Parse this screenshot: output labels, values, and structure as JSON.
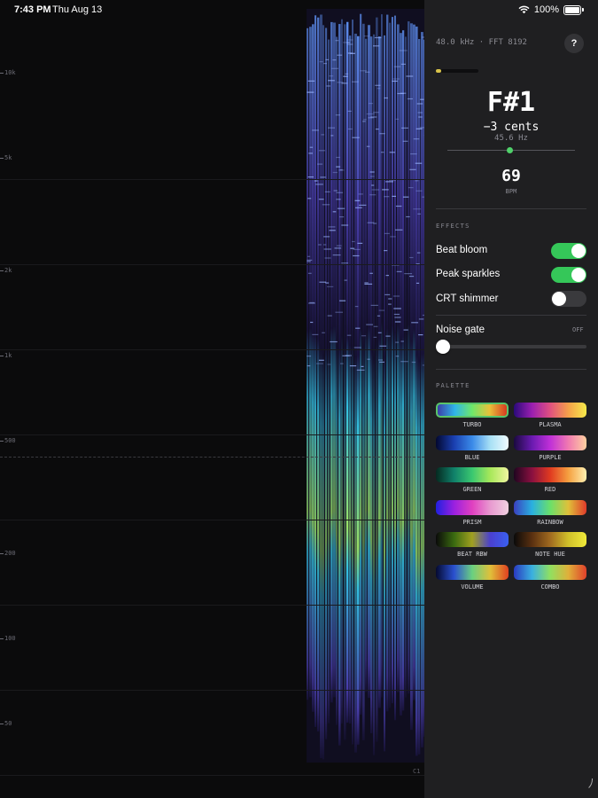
{
  "status_bar": {
    "time": "7:43 PM",
    "date": "Thu Aug 13",
    "battery": "100%"
  },
  "spectrogram": {
    "y_ticks": [
      "10k",
      "5k",
      "2k",
      "1k",
      "500",
      "200",
      "100",
      "50"
    ],
    "bottom_label": "C1",
    "gradient_colors": [
      "#1a1440",
      "#4a3fb0",
      "#5d8ff0",
      "#35c7e8",
      "#9ee86a",
      "#e8e24a"
    ]
  },
  "panel": {
    "meta": "48.0 kHz · FFT 8192",
    "help_label": "?",
    "level": 0.12,
    "note": "F#1",
    "cents": "−3 cents",
    "frequency": "45.6 Hz",
    "tuning_offset": -0.03,
    "bpm_value": "69",
    "bpm_label": "BPM",
    "effects": {
      "title": "EFFECTS",
      "items": [
        {
          "label": "Beat bloom",
          "on": true
        },
        {
          "label": "Peak sparkles",
          "on": true
        },
        {
          "label": "CRT shimmer",
          "on": false
        }
      ]
    },
    "noise_gate": {
      "label": "Noise gate",
      "state": "OFF",
      "value": 0.0
    },
    "palette": {
      "title": "PALETTE",
      "selected": "TURBO",
      "items": [
        {
          "name": "TURBO",
          "colors": [
            "#3b3fa8",
            "#2fb5e8",
            "#6ee86a",
            "#e8c23a",
            "#d83a20"
          ]
        },
        {
          "name": "PLASMA",
          "colors": [
            "#2a0a7a",
            "#9a1fb0",
            "#e05080",
            "#f5a04a",
            "#f5ea4a"
          ]
        },
        {
          "name": "BLUE",
          "colors": [
            "#030830",
            "#1a3fb0",
            "#3a8ae8",
            "#a8e0f5",
            "#f0fbff"
          ]
        },
        {
          "name": "PURPLE",
          "colors": [
            "#1a0a40",
            "#6a1ab0",
            "#c030d8",
            "#f07ab0",
            "#ffd0a0"
          ]
        },
        {
          "name": "GREEN",
          "colors": [
            "#052a20",
            "#10806a",
            "#3ac870",
            "#a8e85a",
            "#f0f5a0"
          ]
        },
        {
          "name": "RED",
          "colors": [
            "#200520",
            "#8a1040",
            "#e03a20",
            "#f5a040",
            "#fff0b0"
          ]
        },
        {
          "name": "PRISM",
          "colors": [
            "#2020e0",
            "#9a20e0",
            "#e040c0",
            "#e89ad0",
            "#f0d0e0"
          ]
        },
        {
          "name": "RAINBOW",
          "colors": [
            "#3a40c0",
            "#2ab0e0",
            "#6ae06a",
            "#e0c03a",
            "#e03a2a"
          ]
        },
        {
          "name": "BEAT RBW",
          "colors": [
            "#0a0a0a",
            "#3a6a10",
            "#a0a020",
            "#4a40d0",
            "#3a60f0"
          ]
        },
        {
          "name": "NOTE HUE",
          "colors": [
            "#0a0a0a",
            "#5a3010",
            "#a06a20",
            "#d0c02a",
            "#f0ea3a"
          ]
        },
        {
          "name": "VOLUME",
          "colors": [
            "#050a30",
            "#2a50d0",
            "#6ad080",
            "#e0c03a",
            "#e04020"
          ]
        },
        {
          "name": "COMBO",
          "colors": [
            "#2a3ac0",
            "#3ab0e0",
            "#90e060",
            "#e0b03a",
            "#e0402a"
          ]
        }
      ]
    }
  }
}
